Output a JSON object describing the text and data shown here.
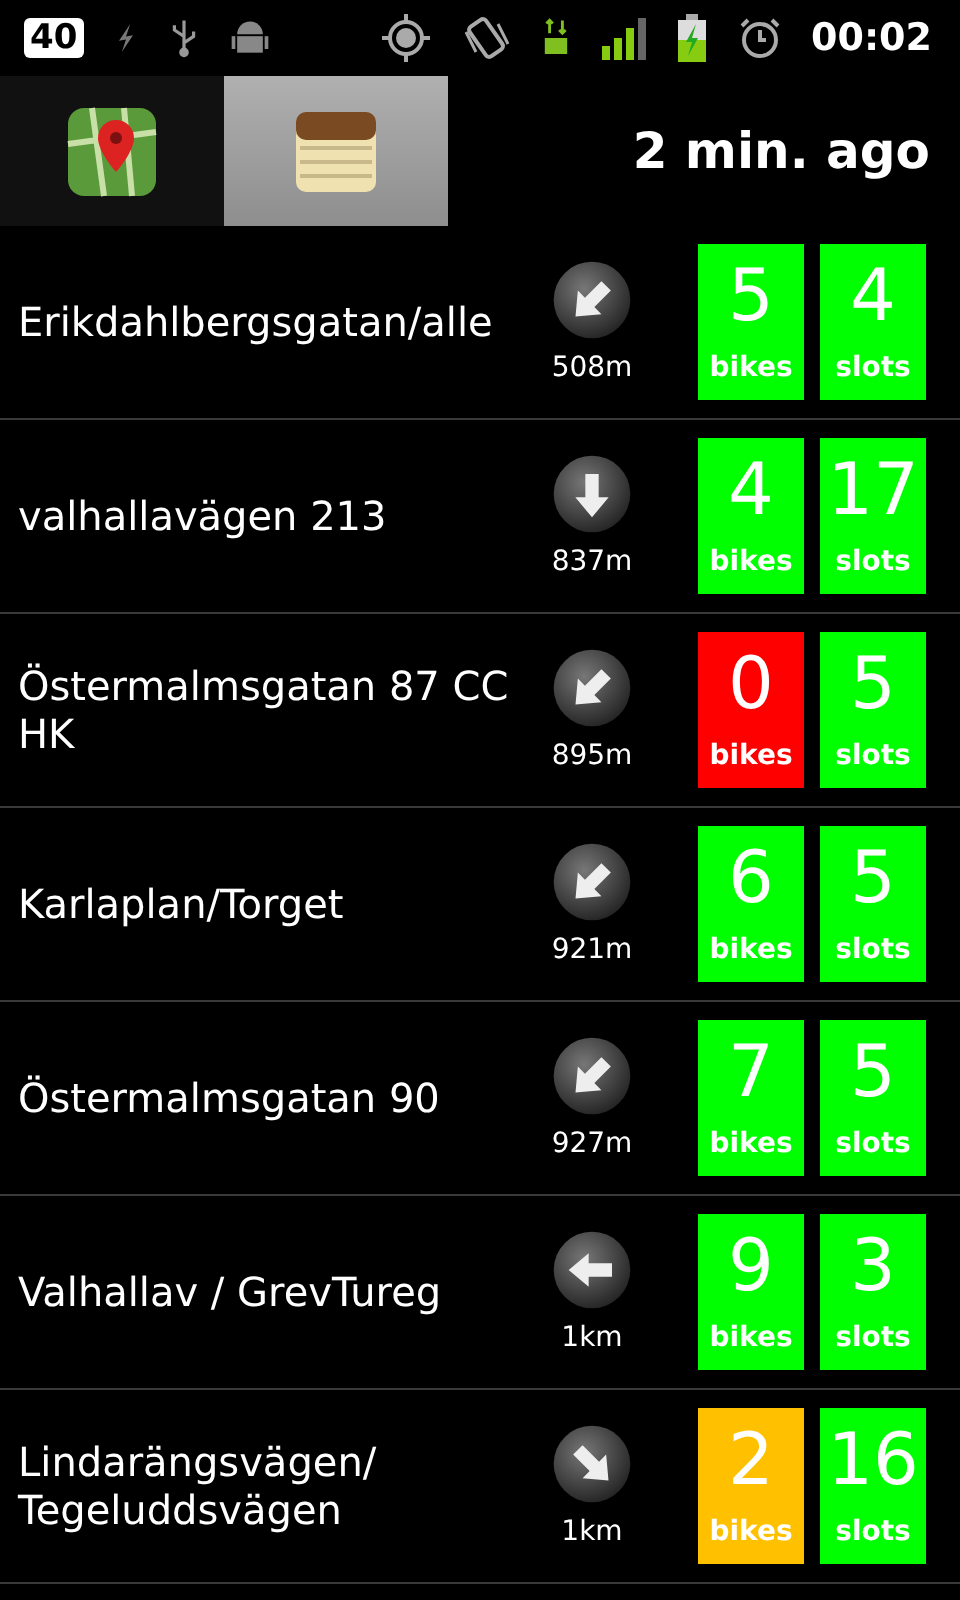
{
  "status_bar": {
    "notification_count": "40",
    "time": "00:02"
  },
  "tabs": [
    {
      "kind": "map",
      "selected": false
    },
    {
      "kind": "list",
      "selected": true
    }
  ],
  "updated": "2 min. ago",
  "stations": [
    {
      "name": "Erikdahlbergsgatan/alle",
      "kind": "southwest",
      "distance": "508m",
      "bikes": {
        "count": "5",
        "label": "bikes",
        "color": "#00ff00"
      },
      "slots": {
        "count": "4",
        "label": "slots",
        "color": "#00ff00"
      }
    },
    {
      "name": "valhallavägen 213",
      "kind": "south",
      "distance": "837m",
      "bikes": {
        "count": "4",
        "label": "bikes",
        "color": "#00ff00"
      },
      "slots": {
        "count": "17",
        "label": "slots",
        "color": "#00ff00"
      }
    },
    {
      "name": "Östermalmsgatan 87 CC HK",
      "kind": "southwest",
      "distance": "895m",
      "bikes": {
        "count": "0",
        "label": "bikes",
        "color": "#ff0000"
      },
      "slots": {
        "count": "5",
        "label": "slots",
        "color": "#00ff00"
      }
    },
    {
      "name": "Karlaplan/Torget",
      "kind": "southwest",
      "distance": "921m",
      "bikes": {
        "count": "6",
        "label": "bikes",
        "color": "#00ff00"
      },
      "slots": {
        "count": "5",
        "label": "slots",
        "color": "#00ff00"
      }
    },
    {
      "name": "Östermalmsgatan 90",
      "kind": "southwest",
      "distance": "927m",
      "bikes": {
        "count": "7",
        "label": "bikes",
        "color": "#00ff00"
      },
      "slots": {
        "count": "5",
        "label": "slots",
        "color": "#00ff00"
      }
    },
    {
      "name": "Valhallav / GrevTureg",
      "kind": "west",
      "distance": "1km",
      "bikes": {
        "count": "9",
        "label": "bikes",
        "color": "#00ff00"
      },
      "slots": {
        "count": "3",
        "label": "slots",
        "color": "#00ff00"
      }
    },
    {
      "name": "Lindarängsvägen/ Tegeluddsvägen",
      "kind": "southeast",
      "distance": "1km",
      "bikes": {
        "count": "2",
        "label": "bikes",
        "color": "#ffc000"
      },
      "slots": {
        "count": "16",
        "label": "slots",
        "color": "#00ff00"
      }
    }
  ]
}
